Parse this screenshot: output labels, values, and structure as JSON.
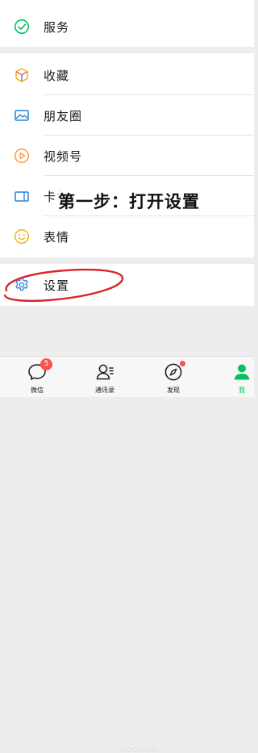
{
  "menu": {
    "services": "服务",
    "favorites": "收藏",
    "moments": "朋友圈",
    "channels": "视频号",
    "cards_partial": "卡包",
    "stickers": "表情",
    "settings": "设置"
  },
  "overlay_caption": "第一步：打开设置",
  "tabbar": {
    "chats": "微信",
    "chats_badge": "5",
    "contacts": "通讯录",
    "discover": "发现",
    "me": "我"
  },
  "colors": {
    "accent": "#07c160",
    "badge": "#fa5151",
    "annotation": "#d9252a"
  }
}
